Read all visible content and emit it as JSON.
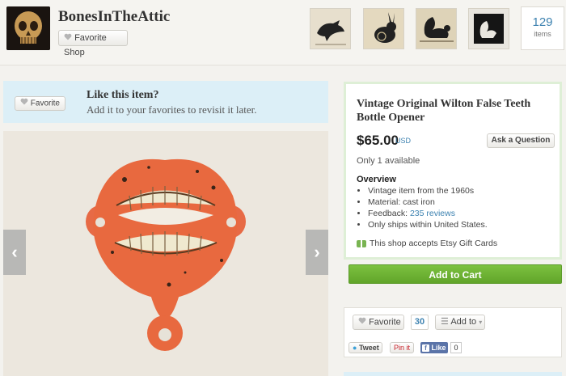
{
  "shop": {
    "name": "BonesInTheAttic",
    "favorite_label": "Favorite Shop",
    "items_count": "129",
    "items_label": "items"
  },
  "thumbnails": [
    {
      "icon": "crow-target-thumbnail"
    },
    {
      "icon": "rabbit-target-thumbnail"
    },
    {
      "icon": "squirrel-target-thumbnail"
    },
    {
      "icon": "squirrel-silhouette-thumbnail"
    }
  ],
  "like_banner": {
    "button_label": "Favorite",
    "title": "Like this item?",
    "subtitle": "Add it to your favorites to revisit it later."
  },
  "photo": {
    "prev_glyph": "‹",
    "next_glyph": "›"
  },
  "item": {
    "title": "Vintage Original Wilton False Teeth Bottle Opener",
    "price": "$65.00",
    "currency": "USD",
    "ask_label": "Ask a Question",
    "availability": "Only 1 available",
    "overview_heading": "Overview",
    "overview": {
      "vintage": "Vintage item from the 1960s",
      "material": "Material: cast iron",
      "feedback_prefix": "Feedback: ",
      "feedback_link": "235 reviews",
      "shipping": "Only ships within United States."
    },
    "gift_text": "This shop accepts Etsy Gift Cards",
    "cart_label": "Add to Cart"
  },
  "social": {
    "favorite_label": "Favorite",
    "favorite_count": "30",
    "add_to_label": "Add to",
    "tweet_label": "Tweet",
    "pin_label": "Pin it",
    "like_label": "Like",
    "like_count": "0"
  },
  "colors": {
    "accent_blue": "#3d82b0",
    "cart_green": "#6cb33a",
    "banner_blue": "#dceff7",
    "facebook": "#5b74a8"
  }
}
